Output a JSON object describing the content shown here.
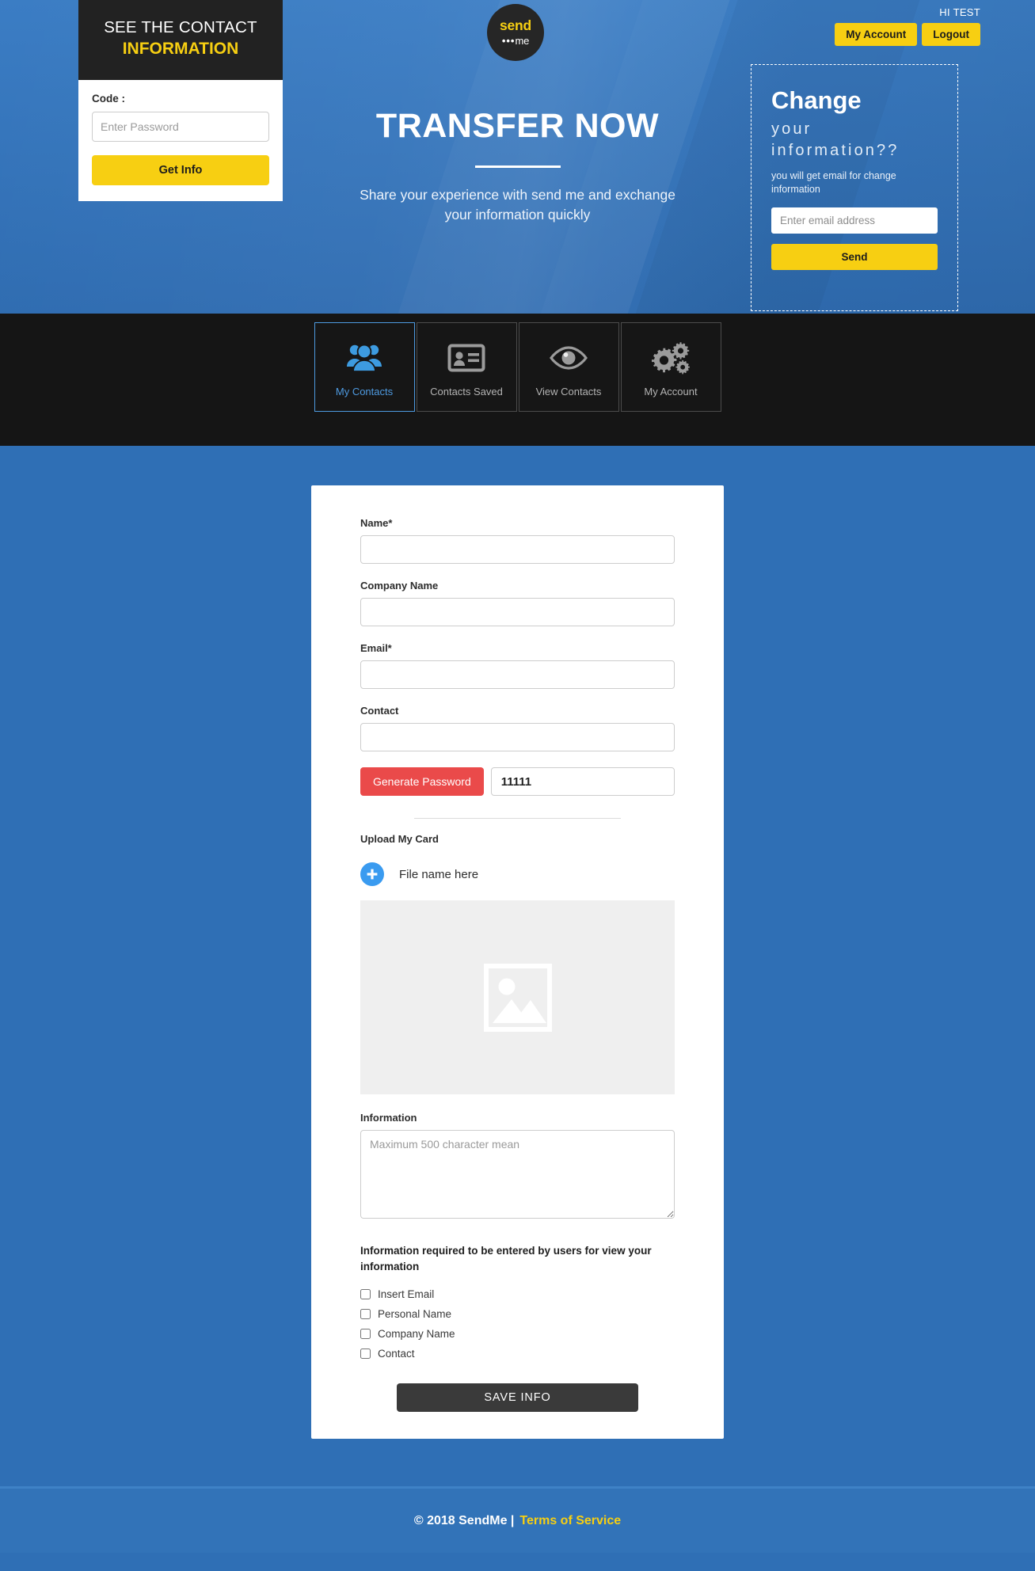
{
  "hero": {
    "code_card": {
      "title_line1": "SEE THE CONTACT",
      "title_line2": "INFORMATION",
      "code_label": "Code :",
      "code_placeholder": "Enter Password",
      "get_info_label": "Get Info"
    },
    "logo": {
      "send": "send",
      "dots": "•••",
      "me": "me"
    },
    "title": "TRANSFER NOW",
    "subtitle": "Share your experience with send me and exchange your information quickly",
    "account": {
      "greeting": "HI TEST",
      "my_account_label": "My Account",
      "logout_label": "Logout"
    },
    "change_panel": {
      "heading": "Change",
      "subheading": "your information??",
      "note": "you will get email for change information",
      "email_placeholder": "Enter email address",
      "send_label": "Send"
    }
  },
  "nav": {
    "items": [
      {
        "label": "My Contacts",
        "icon": "people-group-icon",
        "active": true
      },
      {
        "label": "Contacts Saved",
        "icon": "id-card-icon",
        "active": false
      },
      {
        "label": "View Contacts",
        "icon": "eye-icon",
        "active": false
      },
      {
        "label": "My Account",
        "icon": "gears-icon",
        "active": false
      }
    ]
  },
  "form": {
    "name_label": "Name*",
    "name_value": "",
    "company_label": "Company Name",
    "company_value": "",
    "email_label": "Email*",
    "email_value": "",
    "contact_label": "Contact",
    "contact_value": "",
    "generate_password_label": "Generate Password",
    "password_value": "11111",
    "upload_title": "Upload My Card",
    "upload_filename": "File name here",
    "information_label": "Information",
    "information_placeholder": "Maximum 500 character mean",
    "information_value": "",
    "required_title": "Information required to be entered by users for view your information",
    "checkboxes": [
      {
        "label": "Insert Email",
        "checked": false
      },
      {
        "label": "Personal Name",
        "checked": false
      },
      {
        "label": "Company Name",
        "checked": false
      },
      {
        "label": "Contact",
        "checked": false
      }
    ],
    "save_label": "SAVE INFO"
  },
  "footer": {
    "copyright": "© 2018 SendMe |",
    "terms": "Terms of Service"
  },
  "colors": {
    "brand_blue": "#2f6fb5",
    "accent_yellow": "#f7cf12",
    "dark": "#151515",
    "danger_red": "#ea4a4a",
    "active_tab_blue": "#4e9ae0"
  }
}
